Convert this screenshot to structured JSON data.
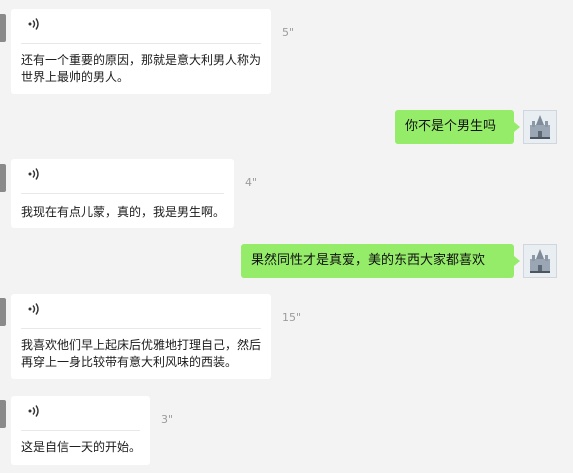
{
  "messages": [
    {
      "side": "received",
      "type": "voice",
      "duration": "5\"",
      "text": "还有一个重要的原因，那就是意大利男人称为\n世界上最帅的男人。"
    },
    {
      "side": "sent",
      "type": "text",
      "text": "你不是个男生吗"
    },
    {
      "side": "received",
      "type": "voice",
      "duration": "4\"",
      "text": "我现在有点儿蒙，真的，我是男生啊。"
    },
    {
      "side": "sent",
      "type": "text",
      "text": "果然同性才是真爱，美的东西大家都喜欢"
    },
    {
      "side": "received",
      "type": "voice",
      "duration": "15\"",
      "text": "我喜欢他们早上起床后优雅地打理自己，然后\n再穿上一身比较带有意大利风味的西装。"
    },
    {
      "side": "received",
      "type": "voice",
      "duration": "3\"",
      "text": "这是自信一天的开始。"
    }
  ],
  "icons": {
    "voice": "voice-wave-icon",
    "avatar": "cathedral-avatar"
  },
  "colors": {
    "background": "#f3f3f3",
    "received_bubble": "#ffffff",
    "sent_bubble": "#95ec69",
    "duration": "#9c9c9c"
  }
}
